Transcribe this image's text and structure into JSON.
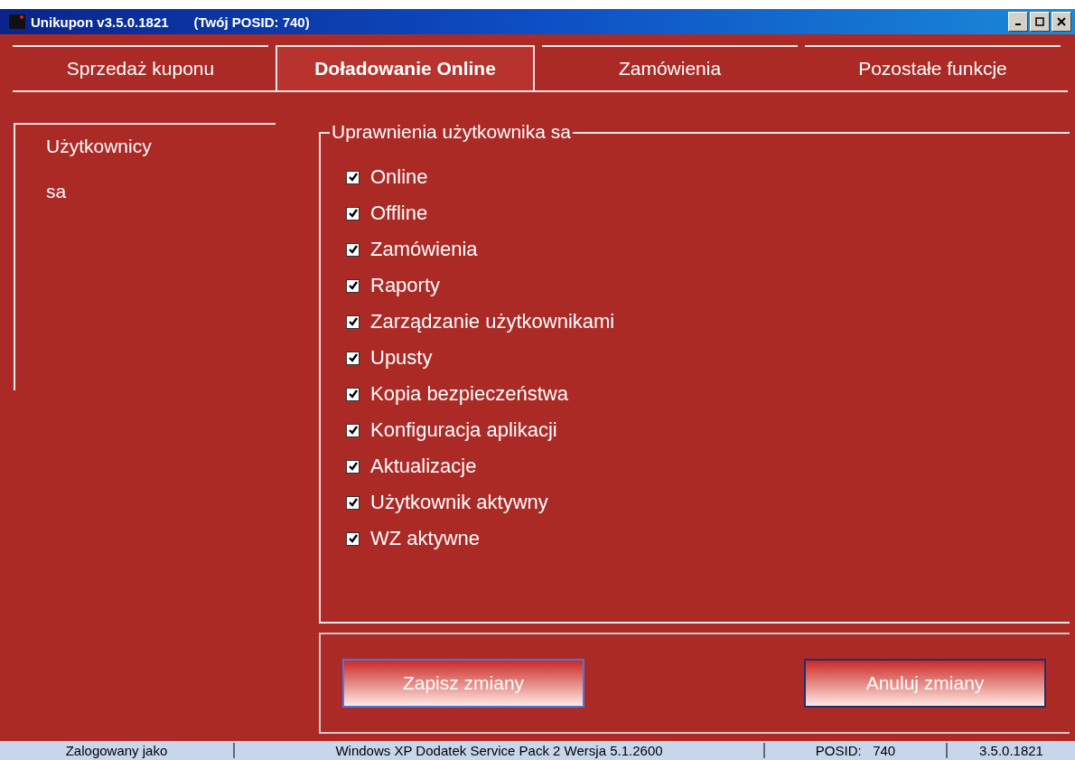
{
  "window": {
    "title": "Unikupon v3.5.0.1821",
    "posid_title": "(Twój POSID: 740)"
  },
  "tabs": [
    {
      "label": "Sprzedaż kuponu",
      "selected": false
    },
    {
      "label": "Doładowanie Online",
      "selected": true
    },
    {
      "label": "Zamówienia",
      "selected": false
    },
    {
      "label": "Pozostałe funkcje",
      "selected": false
    }
  ],
  "users": {
    "heading": "Użytkownicy",
    "items": [
      "sa"
    ]
  },
  "permissions": {
    "title": "Uprawnienia użytkownika sa",
    "items": [
      {
        "label": "Online",
        "checked": true
      },
      {
        "label": "Offline",
        "checked": true
      },
      {
        "label": "Zamówienia",
        "checked": true
      },
      {
        "label": "Raporty",
        "checked": true
      },
      {
        "label": "Zarządzanie użytkownikami",
        "checked": true
      },
      {
        "label": "Upusty",
        "checked": true
      },
      {
        "label": "Kopia bezpieczeństwa",
        "checked": true
      },
      {
        "label": "Konfiguracja aplikacji",
        "checked": true
      },
      {
        "label": "Aktualizacje",
        "checked": true
      },
      {
        "label": "Użytkownik aktywny",
        "checked": true
      },
      {
        "label": "WZ aktywne",
        "checked": true
      }
    ]
  },
  "buttons": [
    {
      "label": "Zapisz zmiany",
      "selected": true
    },
    {
      "label": "Anuluj zmiany",
      "selected": false
    }
  ],
  "status_bar": [
    "Zalogowany jako",
    "Windows XP Dodatek Service Pack 2 Wersja 5.1.2600",
    "POSID:   740",
    "3.5.0.1821"
  ]
}
